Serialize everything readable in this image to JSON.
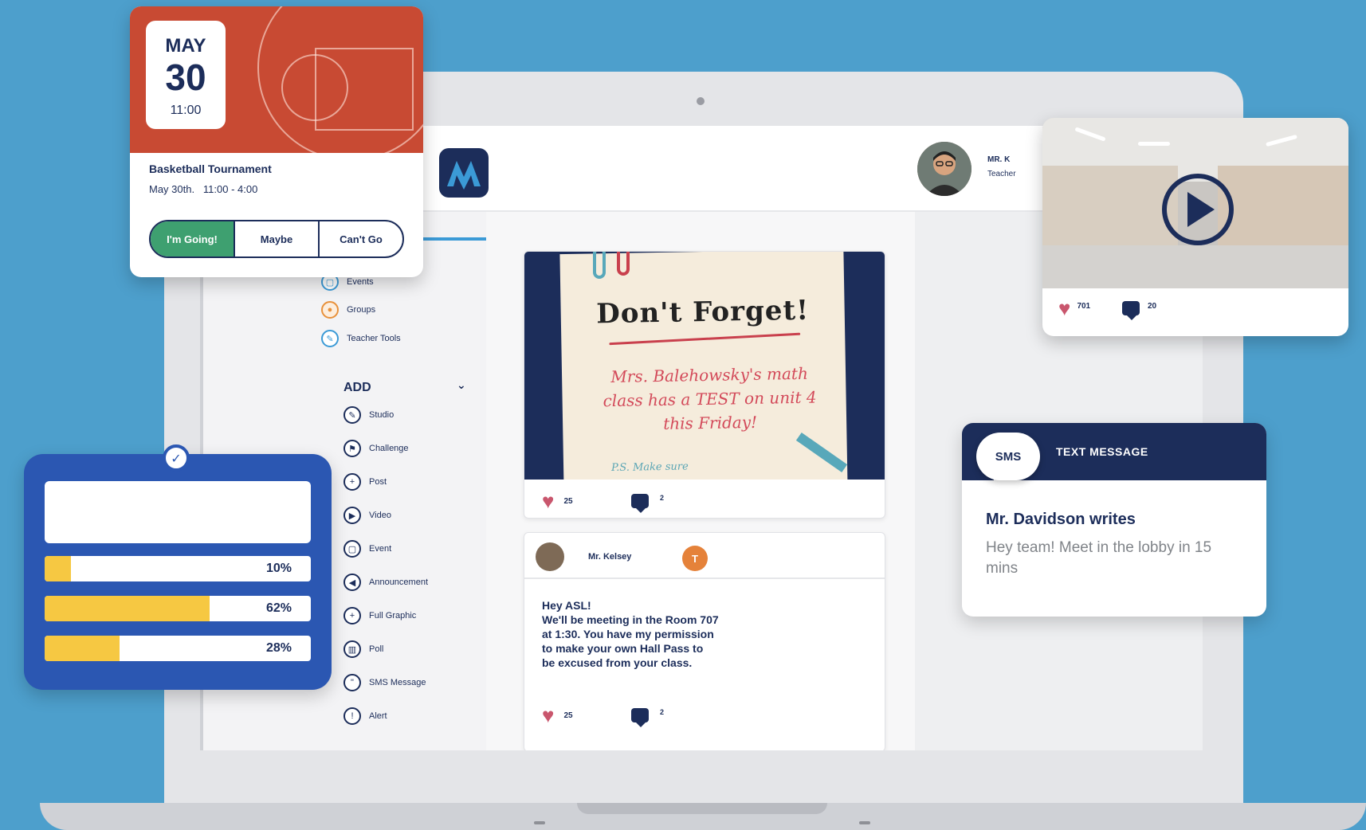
{
  "header": {
    "user_name": "MR. K",
    "user_role": "Teacher"
  },
  "sidebar": {
    "items_top": [
      {
        "label": "Events",
        "icon": "calendar-icon"
      },
      {
        "label": "Groups",
        "icon": "groups-icon"
      },
      {
        "label": "Teacher Tools",
        "icon": "wrench-icon"
      }
    ],
    "add_header": "ADD",
    "add_items": [
      {
        "label": "Studio",
        "icon": "studio-icon"
      },
      {
        "label": "Challenge",
        "icon": "flag-icon"
      },
      {
        "label": "Post",
        "icon": "plus-icon"
      },
      {
        "label": "Video",
        "icon": "play-icon"
      },
      {
        "label": "Event",
        "icon": "calendar-icon"
      },
      {
        "label": "Announcement",
        "icon": "megaphone-icon"
      },
      {
        "label": "Full Graphic",
        "icon": "plus-icon"
      },
      {
        "label": "Poll",
        "icon": "bar-chart-icon"
      },
      {
        "label": "SMS Message",
        "icon": "sms-icon"
      },
      {
        "label": "Alert",
        "icon": "alert-icon"
      }
    ]
  },
  "note_post": {
    "title": "Don't Forget!",
    "body": "Mrs. Balehowsky's math class has a TEST on unit 4 this Friday!",
    "ps": "P.S. Make sure",
    "likes": "25",
    "comments": "2"
  },
  "message_post": {
    "author": "Mr. Kelsey",
    "badge": "T",
    "body": "Hey ASL!\nWe'll be meeting in the Room 707\nat 1:30. You have my permission\nto make your own Hall Pass to\nbe excused from your class.",
    "likes": "25",
    "comments": "2"
  },
  "event_card": {
    "month": "MAY",
    "day": "30",
    "time": "11:00",
    "title": "Basketball Tournament",
    "when": "May 30th.   11:00 - 4:00",
    "rsvp": [
      "I'm Going!",
      "Maybe",
      "Can't Go"
    ]
  },
  "poll": {
    "options": [
      {
        "label": "10%",
        "value": 0.1
      },
      {
        "label": "62%",
        "value": 0.62
      },
      {
        "label": "28%",
        "value": 0.28
      }
    ]
  },
  "video_card": {
    "likes": "701",
    "comments": "20"
  },
  "sms_card": {
    "bubble": "SMS",
    "type": "TEXT MESSAGE",
    "title": "Mr. Davidson writes",
    "text": "Hey team! Meet in the lobby in 15 mins"
  },
  "colors": {
    "background": "#4d9fcc",
    "navy": "#1c2d5a",
    "green": "#3ea070",
    "poll_blue": "#2b57b2",
    "poll_fill": "#f6c842",
    "heart": "#c9566d"
  }
}
